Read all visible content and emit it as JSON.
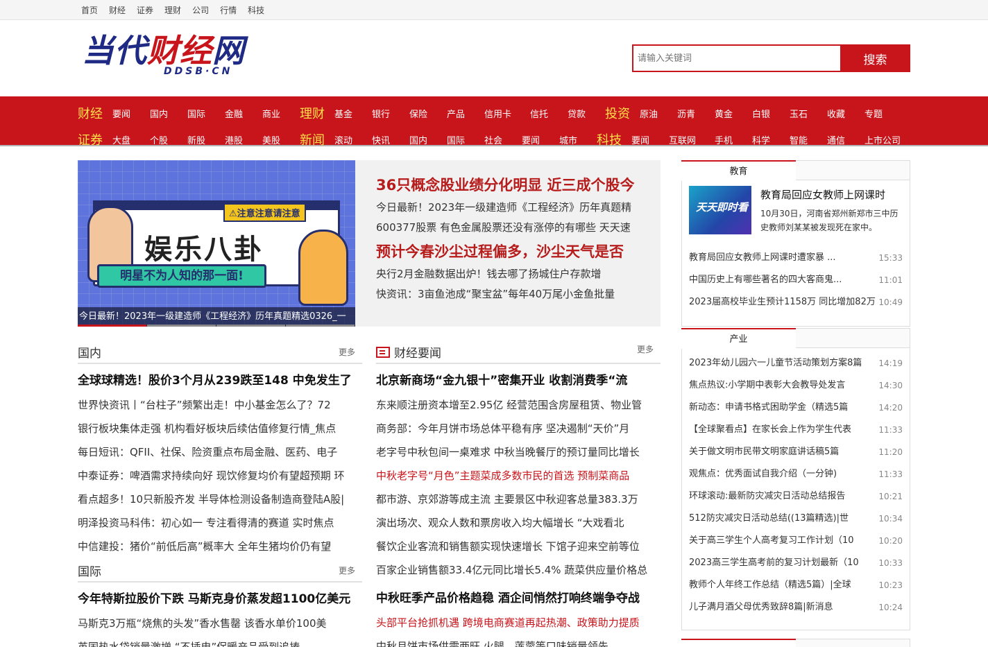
{
  "topbar": [
    "首页",
    "财经",
    "证券",
    "理财",
    "公司",
    "行情",
    "科技"
  ],
  "logo": {
    "main_a": "当代",
    "main_b": "财经",
    "main_c": "网",
    "sub": "DDSB·CN"
  },
  "search": {
    "placeholder": "请输入关键词",
    "button": "搜索"
  },
  "nav": {
    "row1": [
      {
        "cat": "财经",
        "links": [
          "要闻",
          "国内",
          "国际",
          "金融",
          "商业"
        ]
      },
      {
        "cat": "理财",
        "links": [
          "基金",
          "银行",
          "保险",
          "产品",
          "信用卡",
          "信托",
          "贷款"
        ]
      },
      {
        "cat": "投资",
        "links": [
          "原油",
          "沥青",
          "黄金",
          "白银",
          "玉石",
          "收藏",
          "专题"
        ]
      }
    ],
    "row2": [
      {
        "cat": "证券",
        "links": [
          "大盘",
          "个股",
          "新股",
          "港股",
          "美股"
        ]
      },
      {
        "cat": "新闻",
        "links": [
          "滚动",
          "快讯",
          "国内",
          "国际",
          "社会",
          "要闻",
          "城市"
        ]
      },
      {
        "cat": "科技",
        "links": [
          "要闻",
          "互联网",
          "手机",
          "科学",
          "智能",
          "通信",
          "上市公司"
        ]
      }
    ]
  },
  "focus": {
    "banner": {
      "warn": "⚠注意注意请注意",
      "big": "娱乐八卦",
      "pill": "明星不为人知的那一面!",
      "caption": "今日最新！2023年一级建造师《工程经济》历年真题精选0326_一"
    },
    "headline1": "36只概念股业绩分化明显 近三成个股今",
    "lines1": [
      "今日最新！2023年一级建造师《工程经济》历年真题精",
      "600377股票 有色金属股票还没有涨停的有哪些 天天速"
    ],
    "headline2": "预计今春沙尘过程偏多，沙尘天气是否",
    "lines2": [
      "央行2月金融数据出炉！钱去哪了扬城住户存款增",
      "快资讯：3亩鱼池成“聚宝盆”每年40万尾小金鱼批量"
    ]
  },
  "domestic": {
    "title": "国内",
    "more": "更多",
    "head": "全球球精选！股价3个月从239跌至148 中免发生了",
    "items": [
      "世界快资讯丨“台柱子”频繁出走！中小基金怎么了？72",
      "银行板块集体走强 机构看好板块后续估值修复行情_焦点",
      "每日短讯：QFII、社保、险资重点布局金融、医药、电子",
      "中泰证券：啤酒需求持续向好 现饮修复均价有望超预期 环",
      "看点超多！10只新股齐发 半导体检测设备制造商登陆A股|",
      "明泽投资马科伟：初心如一 专注看得清的赛道 实时焦点",
      "中信建投：猪价“前低后高”概率大 全年生猪均价仍有望"
    ]
  },
  "international": {
    "title": "国际",
    "more": "更多",
    "head": "今年特斯拉股价下跌 马斯克身价蒸发超1100亿美元",
    "items": [
      "马斯克3万瓶“烧焦的头发”香水售罄 该香水单价100美",
      "英国热水袋销量激增 “不插电”保暖产品受到追捧"
    ]
  },
  "finance": {
    "title": "财经要闻",
    "more": "更多",
    "head": "北京新商场“金九银十”密集开业 收割消费季“流",
    "items": [
      {
        "text": "东来顺注册资本增至2.95亿 经营范围含房屋租赁、物业管",
        "red": false
      },
      {
        "text": "商务部：今年月饼市场总体平稳有序 坚决遏制“天价”月",
        "red": false
      },
      {
        "text": "老字号中秋包间一桌难求 中秋当晚餐厅的预订量同比增长",
        "red": false
      },
      {
        "text": "中秋老字号“月色”主题菜成多数市民的首选 预制菜商品",
        "red": true
      },
      {
        "text": "都市游、京郊游等成主流 主要景区中秋迎客总量383.3万",
        "red": false
      },
      {
        "text": "演出场次、观众人数和票房收入均大幅增长 “大戏看北",
        "red": false
      },
      {
        "text": "餐饮企业客流和销售额实现快速增长 下馆子迎来空前等位",
        "red": false
      },
      {
        "text": "百家企业销售额33.4亿元同比增长5.4% 蔬菜供应量价格总",
        "red": false
      }
    ],
    "head2": "中秋旺季产品价格趋稳 酒企间悄然打响终端争夺战",
    "items2": [
      {
        "text": "头部平台抢抓机遇 跨境电商赛道再起热潮、政策助力提质",
        "red": true
      },
      {
        "text": "中秋月饼市场供需两旺 火腿、莲蓉等口味销量领先",
        "red": false
      }
    ]
  },
  "sidebar": {
    "education": {
      "tab": "教育",
      "feature": {
        "thumb": "天天即时看",
        "title": "教育局回应女教师上网课时",
        "desc": "10月30日，河南省郑州新郑市三中历史教师刘某某被发现死在家中。"
      },
      "items": [
        {
          "text": "教育局回应女教师上网课时遭家暴 ...",
          "time": "15:33"
        },
        {
          "text": "中国历史上有哪些著名的四大客商鬼...",
          "time": "11:01"
        },
        {
          "text": "2023届高校毕业生预计1158万 同比增加82万",
          "time": "10:49"
        }
      ]
    },
    "industry": {
      "tab": "产业",
      "items": [
        {
          "text": "2023年幼儿园六一儿童节活动策划方案8篇",
          "time": "14:19"
        },
        {
          "text": "焦点热议:小学期中表彰大会教导处发言",
          "time": "14:30"
        },
        {
          "text": "新动态：申请书格式困助学金（精选5篇",
          "time": "14:20"
        },
        {
          "text": "【全球聚看点】在家长会上作为学生代表",
          "time": "11:33"
        },
        {
          "text": "关于做文明市民带文明家庭讲话稿5篇",
          "time": "11:20"
        },
        {
          "text": "观焦点：优秀面试自我介绍（一分钟)",
          "time": "11:33"
        },
        {
          "text": "环球滚动:最新防灾减灾日活动总结报告",
          "time": "10:21"
        },
        {
          "text": "512防灾减灾日活动总结((13篇精选)|世",
          "time": "10:34"
        },
        {
          "text": "关于高三学生个人高考复习工作计划（10",
          "time": "10:20"
        },
        {
          "text": "2023高三学生高考前的复习计划最新（10",
          "time": "10:33"
        },
        {
          "text": "教师个人年终工作总结（精选5篇）|全球",
          "time": "10:23"
        },
        {
          "text": "儿子满月酒父母优秀致辞8篇|新消息",
          "time": "10:24"
        }
      ]
    }
  }
}
